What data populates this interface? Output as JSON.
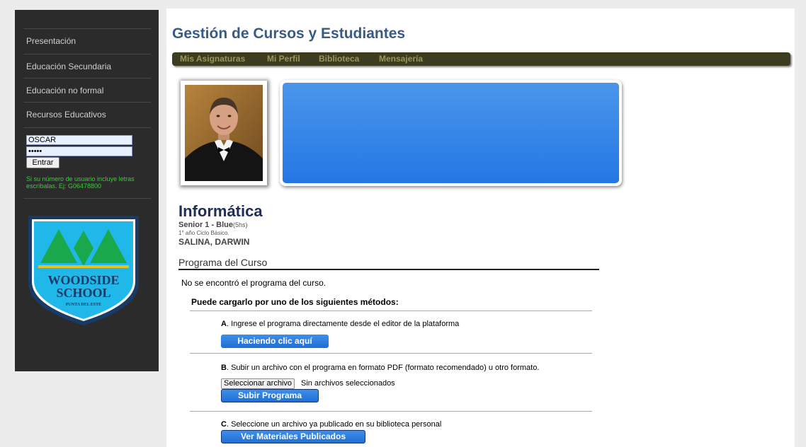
{
  "sidebar": {
    "items": [
      {
        "label": "Presentación"
      },
      {
        "label": "Educación Secundaria"
      },
      {
        "label": "Educación no formal"
      },
      {
        "label": "Recursos Educativos"
      }
    ],
    "login": {
      "username_value": "OSCAR",
      "password_value": "•••••",
      "submit_label": "Entrar",
      "hint": "Si su número de usuario incluye letras escríbalas. Ej: G06478800"
    },
    "logo": {
      "line1": "WOODSIDE",
      "line2": "SCHOOL",
      "line3": "PUNTA DEL ESTE"
    }
  },
  "header": {
    "title": "Gestión de Cursos y Estudiantes",
    "nav": [
      {
        "label": "Mis Asignaturas"
      },
      {
        "label": "Mi Perfil"
      },
      {
        "label": "Biblioteca"
      },
      {
        "label": "Mensajería"
      }
    ]
  },
  "course": {
    "title": "Informática",
    "group": "Senior 1 - Blue",
    "hours": "(5hs)",
    "year": "1° año Ciclo Básico.",
    "teacher": "SALINA, DARWIN"
  },
  "program": {
    "heading": "Programa del Curso",
    "not_found": "No se encontró el programa del curso.",
    "methods_heading": "Puede cargarlo por uno de los siguientes métodos:",
    "method_a": {
      "letter": "A",
      "text": ". Ingrese el programa directamente desde el editor de la plataforma",
      "button": "Haciendo clic aquí"
    },
    "method_b": {
      "letter": "B",
      "text": ". Subir un archivo con el programa en formato PDF (formato recomendado) u otro formato.",
      "file_button": "Seleccionar archivo",
      "file_status": "Sin archivos seleccionados",
      "button": "Subir Programa"
    },
    "method_c": {
      "letter": "C",
      "text": ". Seleccione un archivo ya publicado en su biblioteca personal",
      "button": "Ver Materiales Publicados"
    }
  },
  "colors": {
    "sidebar_bg": "#2b2b2b",
    "nav_bg": "#3c3d20",
    "nav_link": "#9a955c",
    "title": "#3a5a86",
    "button_blue": "#2477e4",
    "hint_green": "#2fd52f",
    "logo_blue": "#1fb8e8",
    "logo_green": "#1aa84d",
    "logo_navy": "#1a3a66"
  }
}
